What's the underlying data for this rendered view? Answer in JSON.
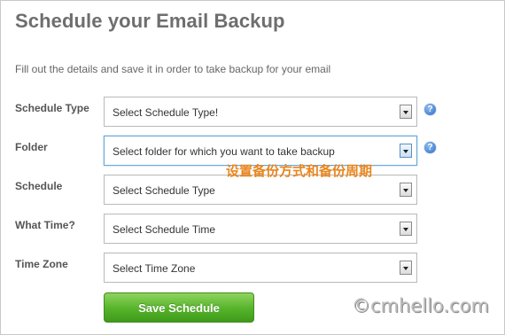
{
  "page": {
    "title": "Schedule your Email Backup",
    "description": "Fill out the details and save it in order to take backup for your email"
  },
  "form": {
    "fields": [
      {
        "label": "Schedule Type",
        "value": "Select Schedule Type!",
        "help_icon": "help-icon"
      },
      {
        "label": "Folder",
        "value": "Select folder for which you want to take backup",
        "help_icon": "help-icon"
      },
      {
        "label": "Schedule",
        "value": "Select Schedule Type"
      },
      {
        "label": "What Time?",
        "value": "Select Schedule Time"
      },
      {
        "label": "Time Zone",
        "value": "Select Time Zone"
      }
    ],
    "save_label": "Save Schedule"
  },
  "annotation": {
    "text": "设置备份方式和备份周期",
    "color": "#e8861e"
  },
  "watermark": {
    "text": "©cmhello.com"
  },
  "colors": {
    "title": "#6e6e6e",
    "button": "#55b32a",
    "help": "#2f6fcb"
  }
}
